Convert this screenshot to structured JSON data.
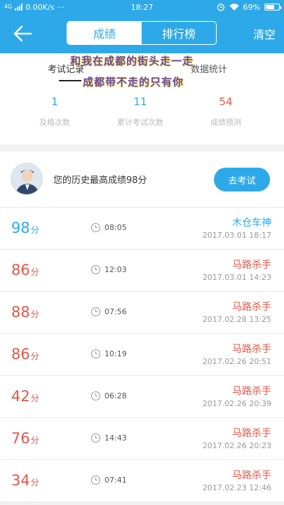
{
  "status_bar": {
    "network": "4G",
    "net_speed": "0.00K/s",
    "dots": "···",
    "time": "18:27",
    "battery": "69%",
    "battery_level": 0.69
  },
  "nav": {
    "tabs": [
      "成绩",
      "排行榜"
    ],
    "active_tab": 0,
    "clear_label": "清空"
  },
  "overlay": {
    "line1": "和我在成都的街头走一走",
    "line2": "成都带不走的只有你"
  },
  "summary": {
    "left_label": "考试记录",
    "right_label": "数据统计",
    "stats": [
      {
        "value": "1",
        "caption": "及格次数",
        "color": "#2da9ea"
      },
      {
        "value": "11",
        "caption": "累计考试次数",
        "color": "#2da9ea"
      },
      {
        "value": "54",
        "caption": "成绩预测",
        "color": "#e0574a"
      }
    ]
  },
  "best": {
    "text": "您的历史最高成绩98分",
    "button": "去考试"
  },
  "records": [
    {
      "score": "98",
      "unit": "分",
      "duration": "08:05",
      "title": "木仓车神",
      "date": "2017.03.01  18:17",
      "color": "blue"
    },
    {
      "score": "86",
      "unit": "分",
      "duration": "12:03",
      "title": "马路杀手",
      "date": "2017.03.01  14:23",
      "color": "red"
    },
    {
      "score": "88",
      "unit": "分",
      "duration": "07:56",
      "title": "马路杀手",
      "date": "2017.02.28  13:25",
      "color": "red"
    },
    {
      "score": "86",
      "unit": "分",
      "duration": "10:19",
      "title": "马路杀手",
      "date": "2017.02.26  20:51",
      "color": "red"
    },
    {
      "score": "42",
      "unit": "分",
      "duration": "06:28",
      "title": "马路杀手",
      "date": "2017.02.26  20:39",
      "color": "red"
    },
    {
      "score": "76",
      "unit": "分",
      "duration": "14:43",
      "title": "马路杀手",
      "date": "2017.02.26  20:23",
      "color": "red"
    },
    {
      "score": "34",
      "unit": "分",
      "duration": "07:41",
      "title": "马路杀手",
      "date": "2017.02.23  12:46",
      "color": "red"
    }
  ]
}
